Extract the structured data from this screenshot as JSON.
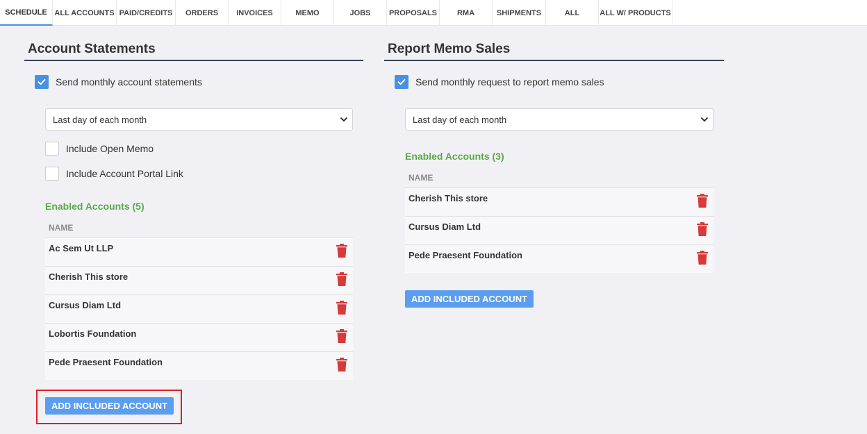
{
  "tabs": [
    {
      "label": "SCHEDULE"
    },
    {
      "label": "ALL ACCOUNTS"
    },
    {
      "label": "PAID/CREDITS"
    },
    {
      "label": "ORDERS"
    },
    {
      "label": "INVOICES"
    },
    {
      "label": "MEMO"
    },
    {
      "label": "JOBS"
    },
    {
      "label": "PROPOSALS"
    },
    {
      "label": "RMA"
    },
    {
      "label": "SHIPMENTS"
    },
    {
      "label": "ALL"
    },
    {
      "label": "ALL W/ PRODUCTS"
    }
  ],
  "account_statements": {
    "title": "Account Statements",
    "send_label": "Send monthly account statements",
    "send_checked": true,
    "schedule_value": "Last day of each month",
    "include_open_memo": "Include Open Memo",
    "include_portal_link": "Include Account Portal Link",
    "enabled_title": "Enabled Accounts (5)",
    "col_name": "NAME",
    "accounts": [
      {
        "name": "Ac Sem Ut LLP"
      },
      {
        "name": "Cherish This store"
      },
      {
        "name": "Cursus Diam Ltd"
      },
      {
        "name": "Lobortis Foundation"
      },
      {
        "name": "Pede Praesent Foundation"
      }
    ],
    "add_label": "ADD INCLUDED ACCOUNT"
  },
  "report_memo_sales": {
    "title": "Report Memo Sales",
    "send_label": "Send monthly request to report memo sales",
    "send_checked": true,
    "schedule_value": "Last day of each month",
    "enabled_title": "Enabled Accounts (3)",
    "col_name": "NAME",
    "accounts": [
      {
        "name": "Cherish This store"
      },
      {
        "name": "Cursus Diam Ltd"
      },
      {
        "name": "Pede Praesent Foundation"
      }
    ],
    "add_label": "ADD INCLUDED ACCOUNT"
  },
  "colors": {
    "accent": "#4a90e2",
    "button": "#5b9ef0",
    "enabled_green": "#5aa84a",
    "trash_red": "#d63a3a",
    "highlight_red": "#e02020"
  }
}
